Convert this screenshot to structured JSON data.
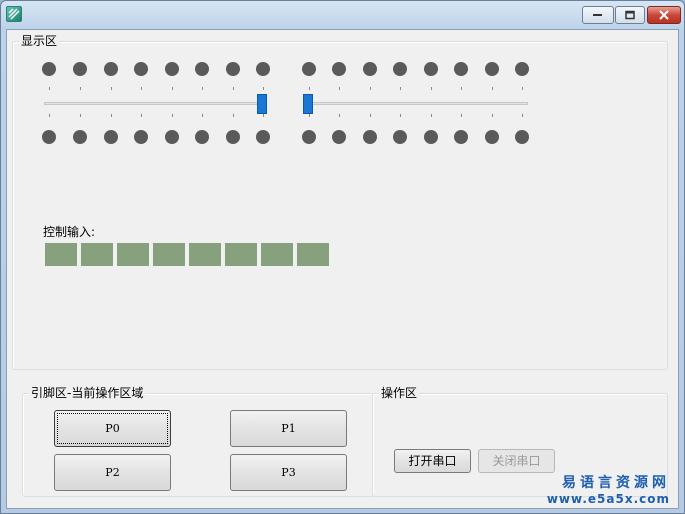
{
  "window": {
    "app_icon": "app-logo-icon",
    "controls": [
      "minimize-icon",
      "maximize-icon",
      "close-icon"
    ]
  },
  "display_area": {
    "label": "显示区",
    "led_rows": 2,
    "leds_per_row": 16,
    "sliders": [
      {
        "name": "left-slider",
        "value_fraction": 0.93
      },
      {
        "name": "right-slider",
        "value_fraction": 0.0
      }
    ],
    "control_input": {
      "label": "控制输入:",
      "cell_count": 8,
      "cell_color": "#87a07e"
    }
  },
  "pin_area": {
    "label": "引脚区-当前操作区域",
    "buttons": [
      {
        "label": "P0",
        "focused": true
      },
      {
        "label": "P1"
      },
      {
        "label": "P2"
      },
      {
        "label": "P3"
      }
    ]
  },
  "operation_area": {
    "label": "操作区",
    "open_port": "打开串口",
    "close_port": "关闭串口",
    "close_port_enabled": false
  },
  "watermark": {
    "cn": "易语言资源网",
    "url": "www.e5a5x.com"
  },
  "colors": {
    "accent": "#1a78d4",
    "led": "#5a5a5a",
    "window_bg": "#f0f0f0"
  }
}
